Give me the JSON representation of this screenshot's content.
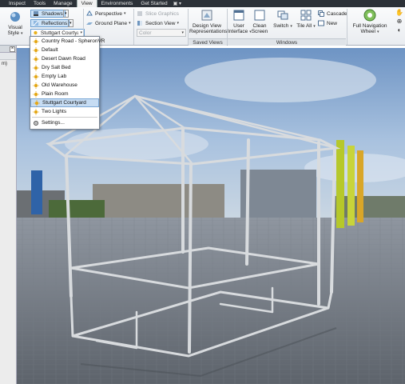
{
  "menu_tabs": [
    "Inspect",
    "Tools",
    "Manage",
    "View",
    "Environments",
    "Get Started"
  ],
  "active_tab": "View",
  "ribbon": {
    "visual_style": "Visual Style",
    "shadows": "Shadows",
    "reflections": "Reflections",
    "environment_select": "Stuttgart Courtyard",
    "perspective": "Perspective",
    "ground_plane": "Ground Plane",
    "slice_graphics": "Slice Graphics",
    "section_view": "Section View",
    "color": "Color",
    "design_view": "Design View Representations",
    "user_interface": "User Interface",
    "clean_screen": "Clean Screen",
    "switch": "Switch",
    "tile_all": "Tile All",
    "cascade": "Cascade",
    "new": "New",
    "full_nav_wheel": "Full Navigation Wheel",
    "panel_saved_views": "Saved Views",
    "panel_windows": "Windows"
  },
  "dropdown": {
    "items": [
      "Country Road - SpheronVR",
      "Default",
      "Desert Dawn Road",
      "Dry Salt Bed",
      "Empty Lab",
      "Old Warehouse",
      "Plain Room",
      "Stuttgart Courtyard",
      "Two Lights"
    ],
    "selected": "Stuttgart Courtyard",
    "settings": "Settings..."
  },
  "browser_label": "m)",
  "colors": {
    "accent": "#1e6fc9",
    "ribbon_bg": "#eef1f4",
    "tabbar_bg": "#2c3138",
    "highlight": "#c6dcf3"
  }
}
